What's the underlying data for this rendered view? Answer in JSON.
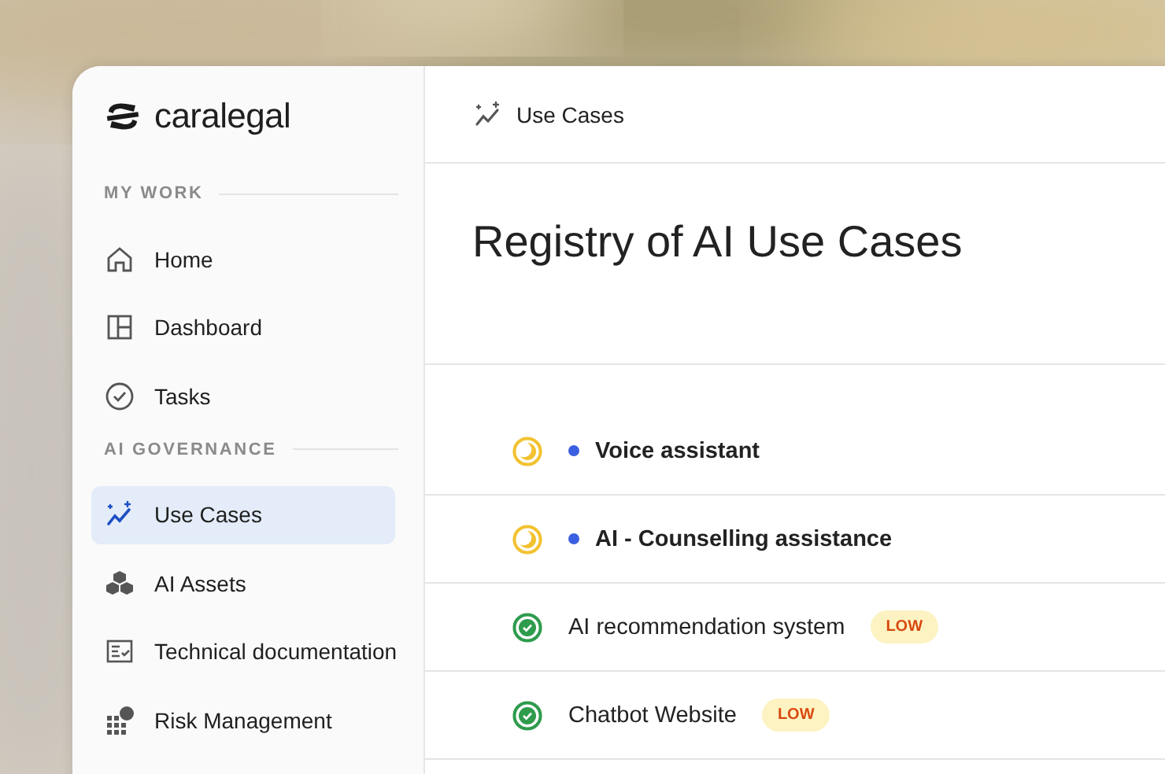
{
  "brand": {
    "name": "caralegal"
  },
  "sidebar": {
    "sections": [
      {
        "label": "MY WORK",
        "items": [
          {
            "label": "Home",
            "selected": false
          },
          {
            "label": "Dashboard",
            "selected": false
          },
          {
            "label": "Tasks",
            "selected": false
          }
        ]
      },
      {
        "label": "AI GOVERNANCE",
        "items": [
          {
            "label": "Use Cases",
            "selected": true
          },
          {
            "label": "AI Assets",
            "selected": false
          },
          {
            "label": "Technical documentation",
            "selected": false
          },
          {
            "label": "Risk Management",
            "selected": false
          }
        ]
      }
    ]
  },
  "breadcrumb": {
    "label": "Use Cases"
  },
  "page_title": "Registry of AI Use Cases",
  "rows": [
    {
      "kind": "pending",
      "name": "Voice assistant",
      "unread": true
    },
    {
      "kind": "pending",
      "name": "AI - Counselling assistance",
      "unread": true
    },
    {
      "kind": "done",
      "name": "AI recommendation system",
      "unread": false,
      "risk": "LOW"
    },
    {
      "kind": "done",
      "name": "Chatbot Website",
      "unread": false,
      "risk": "LOW"
    }
  ]
}
